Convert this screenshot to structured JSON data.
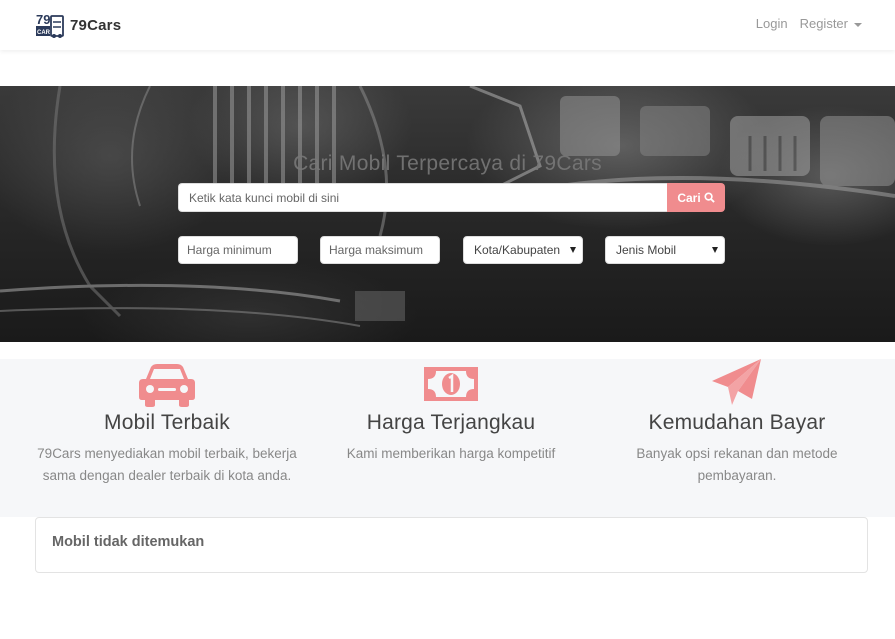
{
  "navbar": {
    "brand_logo_text_top": "79",
    "brand_logo_text_bottom": "CARS",
    "brand_name": "79Cars",
    "login_label": "Login",
    "register_label": "Register"
  },
  "hero": {
    "title": "Cari Mobil Terpercaya di 79Cars",
    "search_placeholder": "Ketik kata kunci mobil di sini",
    "search_button_label": "Cari",
    "min_price_placeholder": "Harga minimum",
    "max_price_placeholder": "Harga maksimum",
    "city_select_value": "Kota/Kabupaten",
    "type_select_value": "Jenis Mobil"
  },
  "features": [
    {
      "icon": "car-icon",
      "title": "Mobil Terbaik",
      "description": "79Cars menyediakan mobil terbaik, bekerja sama dengan dealer terbaik di kota anda."
    },
    {
      "icon": "money-bill-icon",
      "title": "Harga Terjangkau",
      "description": "Kami memberikan harga kompetitif"
    },
    {
      "icon": "paper-plane-icon",
      "title": "Kemudahan Bayar",
      "description": "Banyak opsi rekanan dan metode pembayaran."
    }
  ],
  "results": {
    "empty_message": "Mobil tidak ditemukan"
  },
  "colors": {
    "accent": "#f08c8e",
    "brand_dark": "#2b3a5a",
    "feature_bg": "#f6f7f9"
  }
}
